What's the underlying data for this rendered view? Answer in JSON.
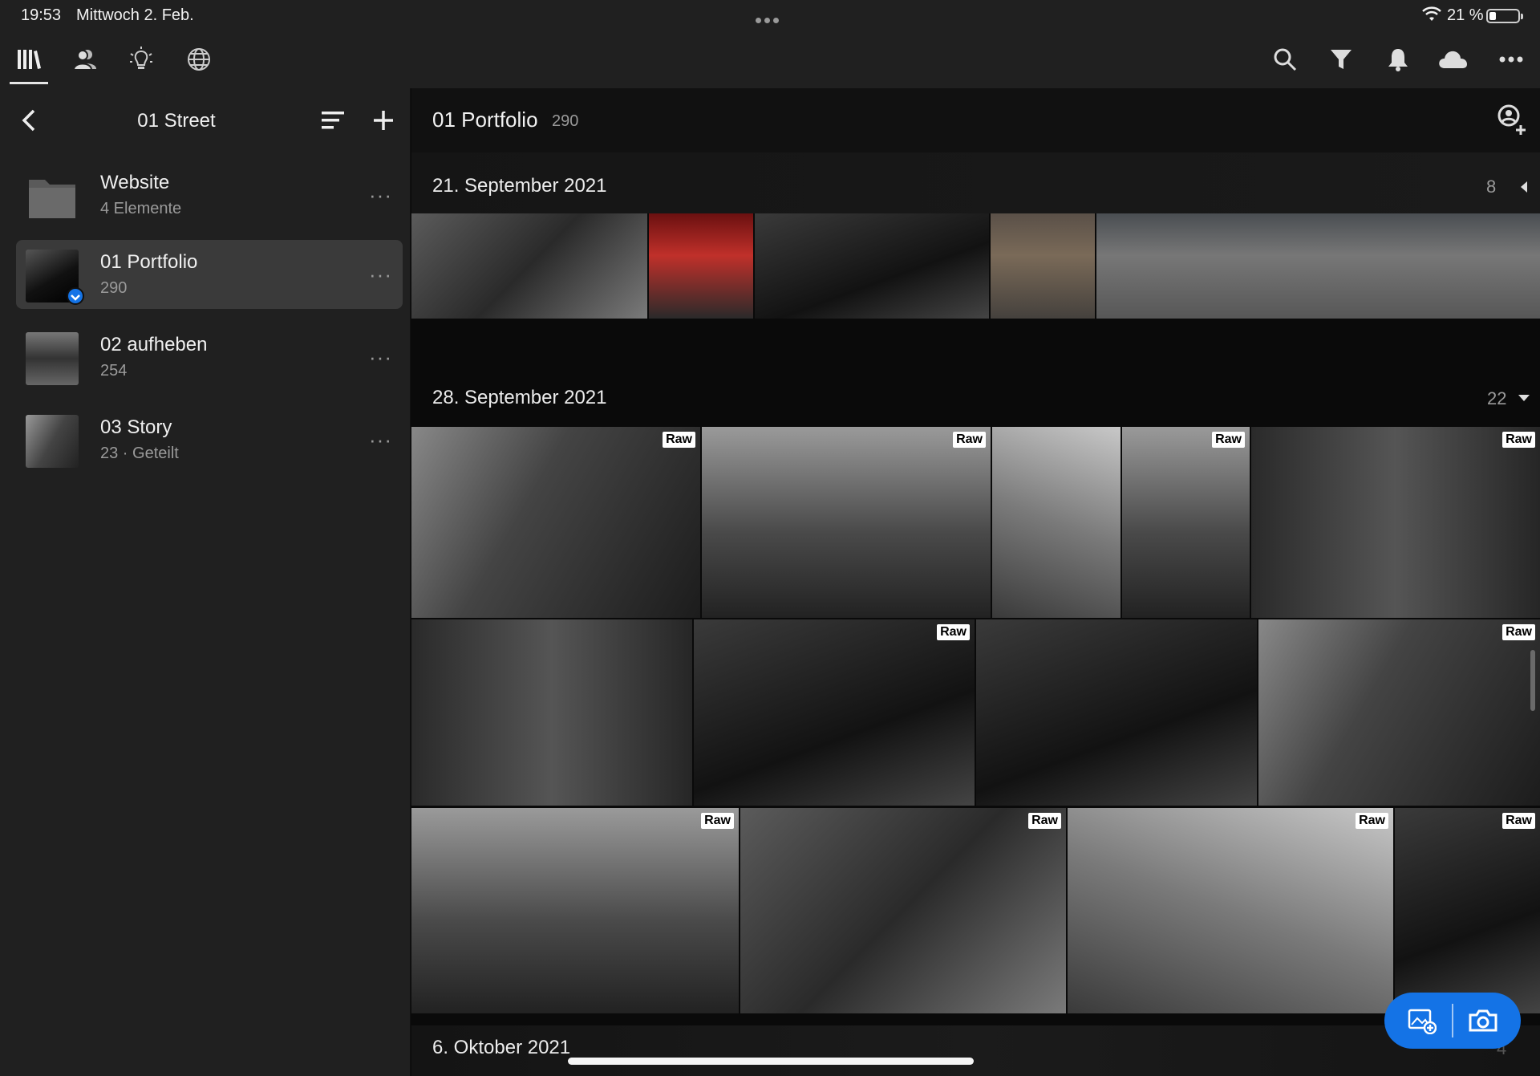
{
  "status_bar": {
    "time": "19:53",
    "date": "Mittwoch 2. Feb.",
    "battery_percent": "21 %"
  },
  "toolbar": {
    "left_icons": [
      "library-icon",
      "people-icon",
      "learn-bulb-icon",
      "discover-globe-icon"
    ],
    "right_icons": [
      "search-icon",
      "filter-icon",
      "notification-bell-icon",
      "cloud-icon",
      "more-icon"
    ]
  },
  "sidebar": {
    "title": "01 Street",
    "items": [
      {
        "name": "Website",
        "sub": "4 Elemente",
        "type": "folder"
      },
      {
        "name": "01 Portfolio",
        "sub": "290",
        "type": "album",
        "active": true
      },
      {
        "name": "02 aufheben",
        "sub": "254",
        "type": "album"
      },
      {
        "name": "03 Story",
        "sub": "23 · Geteilt",
        "type": "album"
      }
    ]
  },
  "main": {
    "title": "01 Portfolio",
    "count": "290",
    "raw_badge": "Raw",
    "sections": [
      {
        "label": "21. September 2021",
        "count": "8",
        "collapsed": true
      },
      {
        "label": "28. September 2021",
        "count": "22",
        "collapsed": false
      },
      {
        "label": "6. Oktober 2021",
        "count": "4",
        "collapsed": true
      }
    ]
  },
  "colors": {
    "accent": "#1473e6",
    "panel": "#202020",
    "background": "#0a0a0a"
  }
}
